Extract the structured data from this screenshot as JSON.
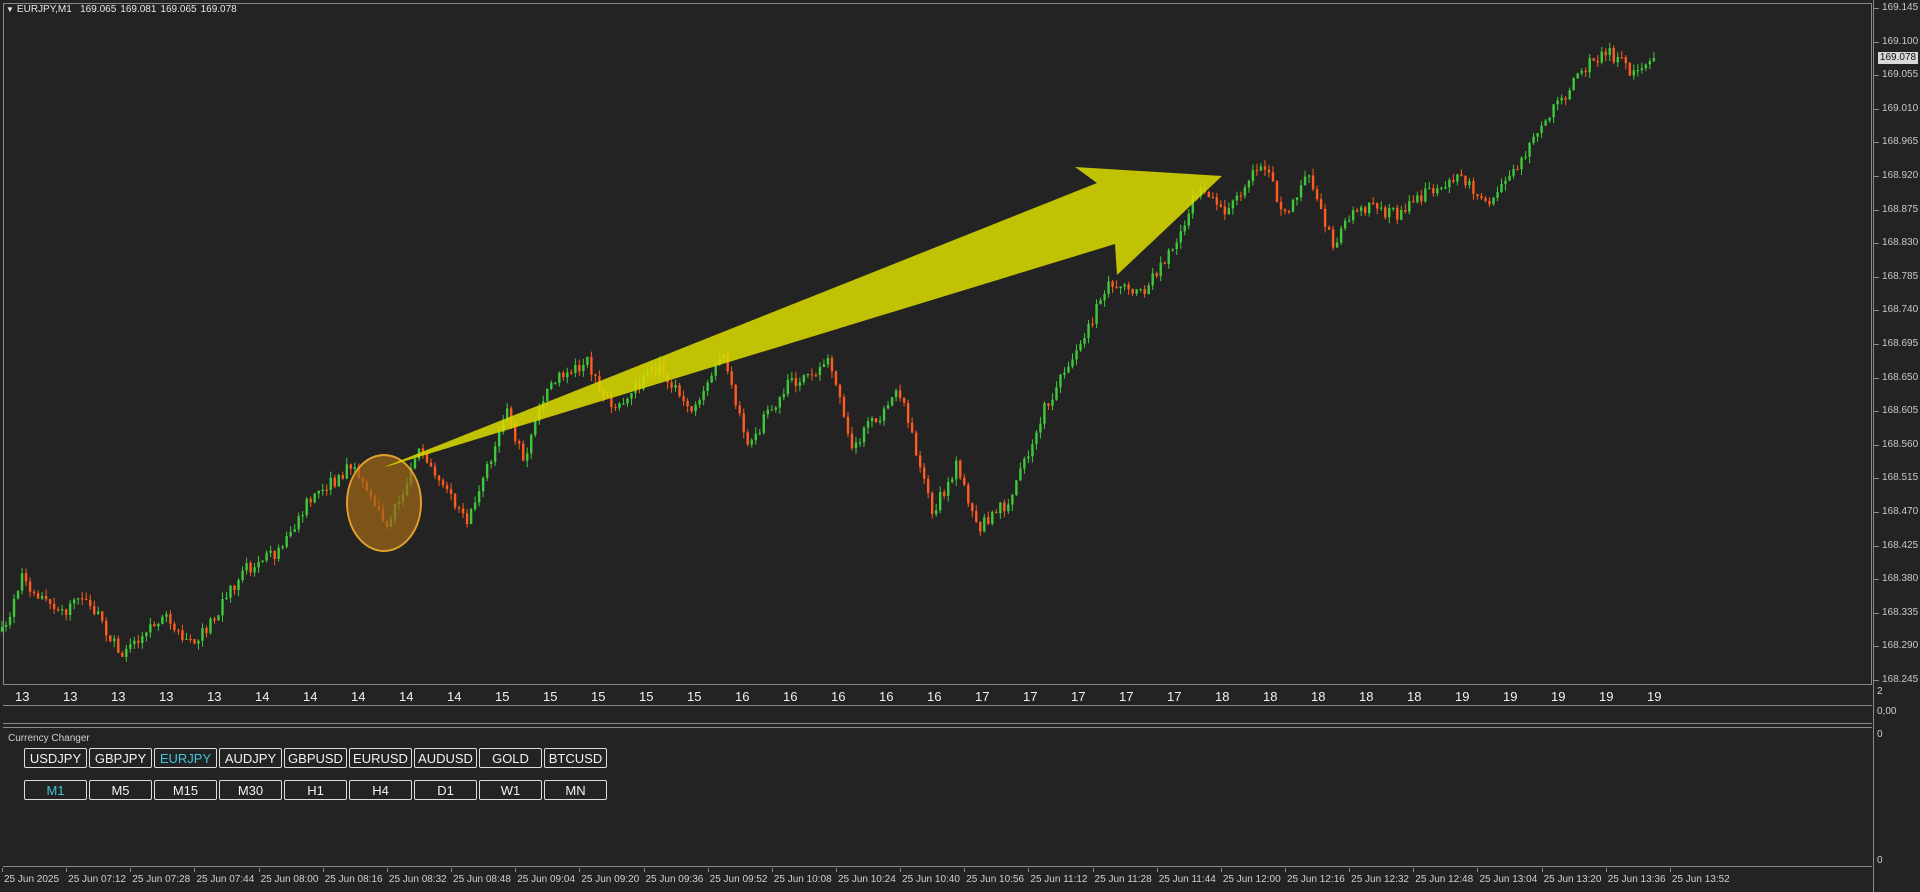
{
  "header": {
    "symbol": "EURJPY,M1",
    "ohlc": [
      "169.065",
      "169.081",
      "169.065",
      "169.078"
    ]
  },
  "price_axis": {
    "labels": [
      "169.145",
      "169.100",
      "169.055",
      "169.010",
      "168.965",
      "168.920",
      "168.875",
      "168.830",
      "168.785",
      "168.740",
      "168.695",
      "168.650",
      "168.605",
      "168.560",
      "168.515",
      "168.470",
      "168.425",
      "168.380",
      "168.335",
      "168.290",
      "168.245"
    ],
    "current_price": "169.078",
    "mini_labels": [
      "2",
      "0,00",
      "0",
      "0",
      "0"
    ]
  },
  "hour_labels": [
    "13",
    "13",
    "13",
    "13",
    "13",
    "14",
    "14",
    "14",
    "14",
    "14",
    "15",
    "15",
    "15",
    "15",
    "15",
    "16",
    "16",
    "16",
    "16",
    "16",
    "17",
    "17",
    "17",
    "17",
    "17",
    "18",
    "18",
    "18",
    "18",
    "18",
    "19",
    "19",
    "19",
    "19",
    "19"
  ],
  "panel": {
    "title": "Currency Changer",
    "currencies": [
      "USDJPY",
      "GBPJPY",
      "EURJPY",
      "AUDJPY",
      "GBPUSD",
      "EURUSD",
      "AUDUSD",
      "GOLD",
      "BTCUSD"
    ],
    "active_currency": "EURJPY",
    "timeframes": [
      "M1",
      "M5",
      "M15",
      "M30",
      "H1",
      "H4",
      "D1",
      "W1",
      "MN"
    ],
    "active_timeframe": "M1"
  },
  "time_axis": [
    "25 Jun 2025",
    "25 Jun 07:12",
    "25 Jun 07:28",
    "25 Jun 07:44",
    "25 Jun 08:00",
    "25 Jun 08:16",
    "25 Jun 08:32",
    "25 Jun 08:48",
    "25 Jun 09:04",
    "25 Jun 09:20",
    "25 Jun 09:36",
    "25 Jun 09:52",
    "25 Jun 10:08",
    "25 Jun 10:24",
    "25 Jun 10:40",
    "25 Jun 10:56",
    "25 Jun 11:12",
    "25 Jun 11:28",
    "25 Jun 11:44",
    "25 Jun 12:00",
    "25 Jun 12:16",
    "25 Jun 12:32",
    "25 Jun 12:48",
    "25 Jun 13:04",
    "25 Jun 13:20",
    "25 Jun 13:36",
    "25 Jun 13:52"
  ],
  "colors": {
    "background": "#232323",
    "bull_candle": "#3fc93a",
    "bear_candle": "#ff5a1f",
    "arrow": "#d8d800",
    "circle": "#e0a030",
    "active_button_text": "#3fc5d6"
  },
  "chart_data": {
    "type": "candlestick",
    "symbol": "EURJPY",
    "timeframe": "M1",
    "ylim": [
      168.245,
      169.145
    ],
    "last_close": 169.078,
    "path_points": [
      {
        "t": "07:00",
        "price": 168.31
      },
      {
        "t": "07:05",
        "price": 168.38
      },
      {
        "t": "07:15",
        "price": 168.335
      },
      {
        "t": "07:20",
        "price": 168.36
      },
      {
        "t": "07:30",
        "price": 168.28
      },
      {
        "t": "07:40",
        "price": 168.33
      },
      {
        "t": "07:48",
        "price": 168.29
      },
      {
        "t": "08:00",
        "price": 168.39
      },
      {
        "t": "08:10",
        "price": 168.42
      },
      {
        "t": "08:16",
        "price": 168.48
      },
      {
        "t": "08:28",
        "price": 168.535
      },
      {
        "t": "08:36",
        "price": 168.45
      },
      {
        "t": "08:44",
        "price": 168.55
      },
      {
        "t": "08:56",
        "price": 168.46
      },
      {
        "t": "09:06",
        "price": 168.6
      },
      {
        "t": "09:10",
        "price": 168.54
      },
      {
        "t": "09:16",
        "price": 168.64
      },
      {
        "t": "09:26",
        "price": 168.67
      },
      {
        "t": "09:32",
        "price": 168.61
      },
      {
        "t": "09:44",
        "price": 168.665
      },
      {
        "t": "09:52",
        "price": 168.6
      },
      {
        "t": "10:00",
        "price": 168.68
      },
      {
        "t": "10:06",
        "price": 168.56
      },
      {
        "t": "10:16",
        "price": 168.64
      },
      {
        "t": "10:26",
        "price": 168.67
      },
      {
        "t": "10:32",
        "price": 168.56
      },
      {
        "t": "10:44",
        "price": 168.63
      },
      {
        "t": "10:52",
        "price": 168.47
      },
      {
        "t": "10:58",
        "price": 168.53
      },
      {
        "t": "11:04",
        "price": 168.45
      },
      {
        "t": "11:12",
        "price": 168.49
      },
      {
        "t": "11:20",
        "price": 168.61
      },
      {
        "t": "11:30",
        "price": 168.7
      },
      {
        "t": "11:36",
        "price": 168.78
      },
      {
        "t": "11:44",
        "price": 168.76
      },
      {
        "t": "11:52",
        "price": 168.82
      },
      {
        "t": "11:58",
        "price": 168.9
      },
      {
        "t": "12:06",
        "price": 168.87
      },
      {
        "t": "12:14",
        "price": 168.94
      },
      {
        "t": "12:20",
        "price": 168.87
      },
      {
        "t": "12:26",
        "price": 168.92
      },
      {
        "t": "12:32",
        "price": 168.83
      },
      {
        "t": "12:38",
        "price": 168.88
      },
      {
        "t": "12:48",
        "price": 168.87
      },
      {
        "t": "12:56",
        "price": 168.9
      },
      {
        "t": "13:04",
        "price": 168.92
      },
      {
        "t": "13:10",
        "price": 168.88
      },
      {
        "t": "13:18",
        "price": 168.93
      },
      {
        "t": "13:26",
        "price": 169.0
      },
      {
        "t": "13:34",
        "price": 169.06
      },
      {
        "t": "13:40",
        "price": 169.09
      },
      {
        "t": "13:46",
        "price": 169.06
      },
      {
        "t": "13:52",
        "price": 169.078
      }
    ]
  }
}
